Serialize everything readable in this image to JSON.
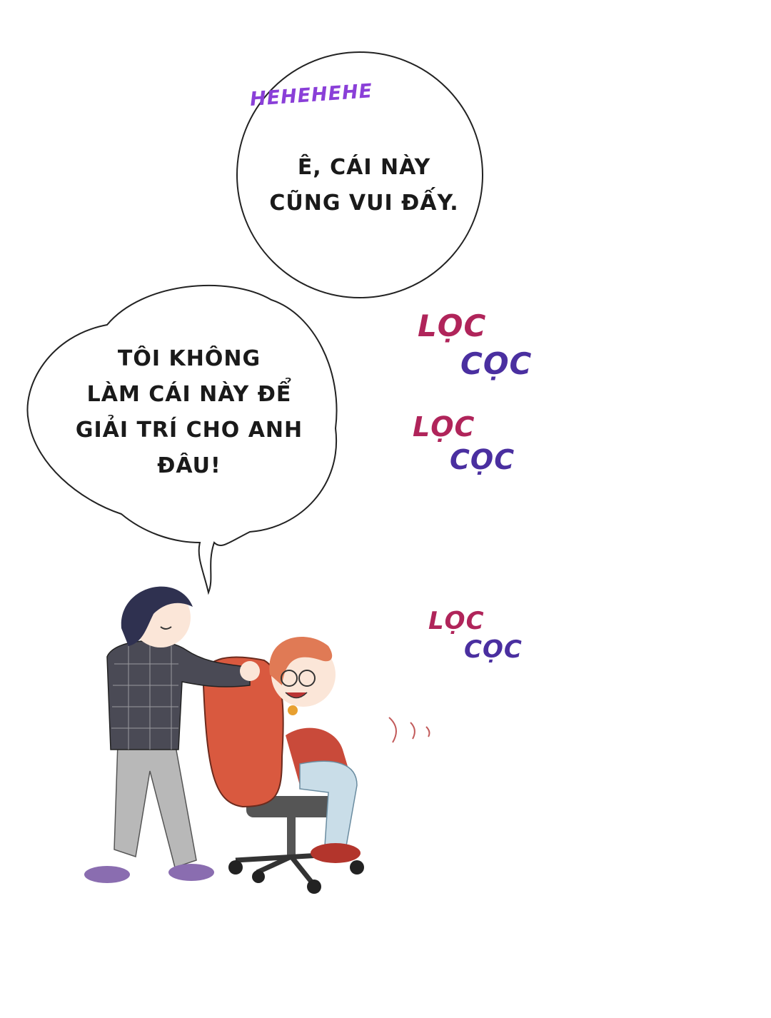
{
  "bubble1": {
    "lines": [
      "Ê, CÁI NÀY",
      "CŨNG VUI ĐẤY."
    ]
  },
  "bubble2": {
    "lines": [
      "TÔI KHÔNG",
      "LÀM CÁI NÀY ĐỂ",
      "GIẢI TRÍ CHO ANH",
      "ĐÂU!"
    ]
  },
  "sfx": {
    "laugh": "HEHEHEHE",
    "rattle": [
      {
        "a": "LỌC",
        "b": "CỌC"
      },
      {
        "a": "LỌC",
        "b": "CỌC"
      },
      {
        "a": "LỌC",
        "b": "CỌC"
      }
    ]
  },
  "colors": {
    "laugh": "#8a3fd8",
    "loc": "#b0245a",
    "coc": "#4a2fa0"
  }
}
